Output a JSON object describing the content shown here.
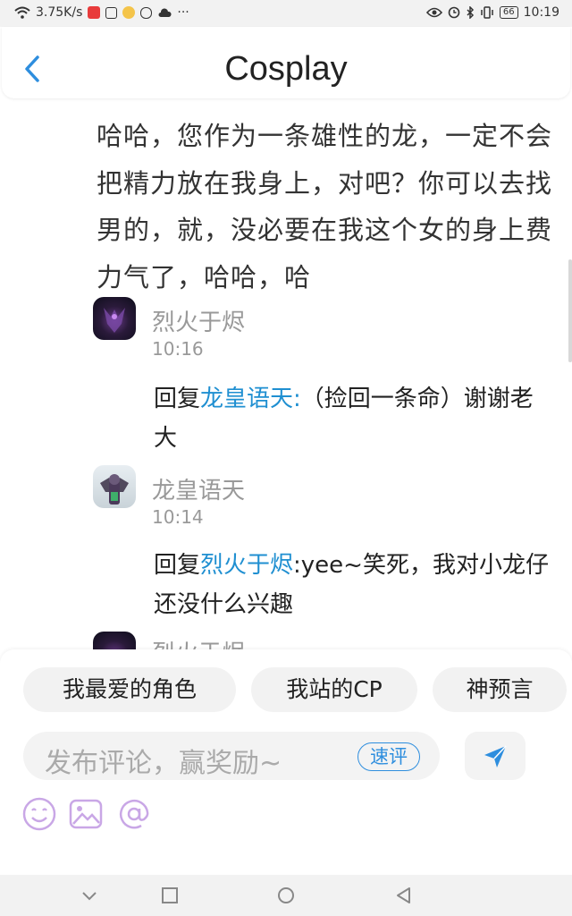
{
  "status_bar": {
    "speed": "3.75K/s",
    "battery": "66",
    "time": "10:19",
    "icons": [
      "wifi-icon",
      "video-icon",
      "tv-icon",
      "face-icon",
      "cloud-icon",
      "more-icon",
      "eye-icon",
      "alarm-icon",
      "bluetooth-icon",
      "vibrate-icon",
      "battery-icon"
    ]
  },
  "header": {
    "title": "Cosplay",
    "back_icon": "chevron-left-icon"
  },
  "post": {
    "text": "哈哈，您作为一条雄性的龙，一定不会把精力放在我身上，对吧？你可以去找男的，就，没必要在我这个女的身上费力气了，哈哈，哈"
  },
  "comments": [
    {
      "username": "烈火于烬",
      "time": "10:16",
      "reply_prefix": "回复",
      "mention": "龙皇语天:",
      "text": "（捡回一条命）谢谢老大"
    },
    {
      "username": "龙皇语天",
      "time": "10:14",
      "reply_prefix": "回复",
      "mention": "烈火于烬",
      "text": ":yee~笑死，我对小龙仔还没什么兴趣"
    },
    {
      "username": "烈火于烬"
    }
  ],
  "chips": [
    "我最爱的角色",
    "我站的CP",
    "神预言"
  ],
  "input": {
    "placeholder": "发布评论，赢奖励~",
    "quick_label": "速评"
  },
  "colors": {
    "accent": "#2e8ede",
    "mention": "#1f8fd1",
    "tool": "#c9a7e6"
  }
}
